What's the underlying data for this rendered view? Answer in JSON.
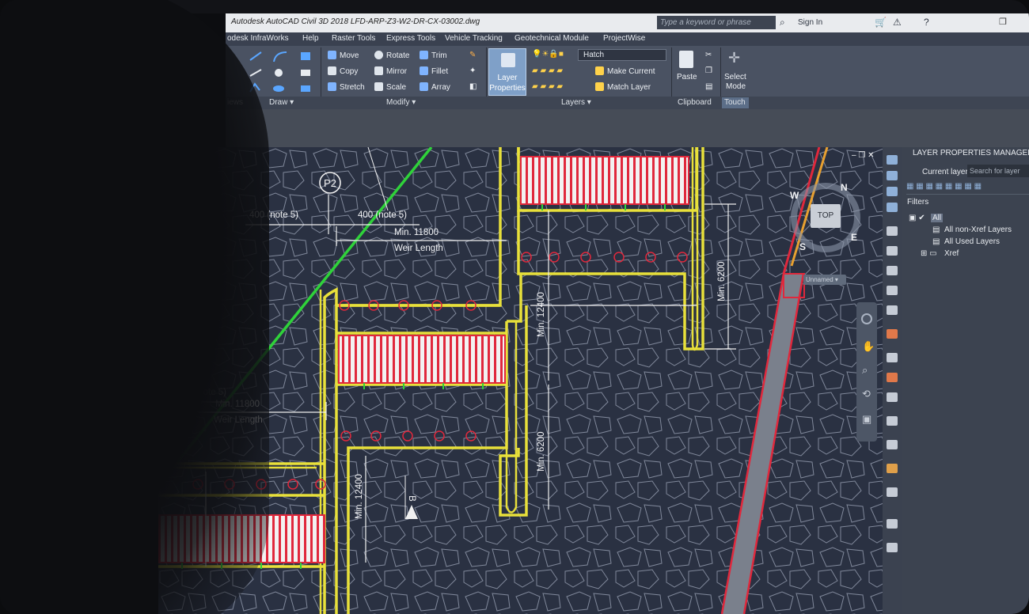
{
  "window": {
    "title": "Autodesk AutoCAD Civil 3D 2018    LFD-ARP-Z3-W2-DR-CX-03002.dwg",
    "search_placeholder": "Type a keyword or phrase",
    "sign_in": "Sign In"
  },
  "menu": [
    "odesk InfraWorks",
    "Help",
    "Raster Tools",
    "Express Tools",
    "Vehicle Tracking",
    "Geotechnical Module",
    "ProjectWise"
  ],
  "ribbon": {
    "panels": [
      "iews",
      "Draw ▾",
      "Modify ▾",
      "Layers ▾",
      "Clipboard",
      "Touch"
    ],
    "modify": [
      "Move",
      "Rotate",
      "Trim",
      "Copy",
      "Mirror",
      "Fillet",
      "Stretch",
      "Scale",
      "Array"
    ],
    "layer_properties": [
      "Layer",
      "Properties"
    ],
    "hatch_dropdown": "Hatch",
    "layers": [
      "Make Current",
      "Match Layer"
    ],
    "clipboard": "Paste",
    "touch": [
      "Select",
      "Mode"
    ]
  },
  "drawing": {
    "callout": "P2",
    "dims": [
      "400 (note 5)",
      "400 (note 5)",
      "Min. 11800",
      "Weir Length",
      "400 (note 5)",
      "Min. 11800",
      "Weir Length"
    ],
    "vertical_dims": [
      "Min. 12400",
      "Min. 6200",
      "Min. 6200",
      "Min. 12400"
    ],
    "section_mark": "B",
    "colors": {
      "background": "#2a3142",
      "yellow": "#e8e03a",
      "red": "#e0283c",
      "green": "#2fd23a",
      "white": "#f0f0f0",
      "linework": "#aab1c2"
    }
  },
  "viewcube": {
    "top": "TOP",
    "n": "N",
    "e": "E",
    "s": "S",
    "w": "W",
    "ucs": "Unnamed ▾"
  },
  "layer_panel": {
    "title": "LAYER PROPERTIES MANAGER",
    "current_layer": "Current layer",
    "search_placeholder": "Search for layer",
    "filters_label": "Filters",
    "tree": [
      "All",
      "All non-Xref Layers",
      "All Used Layers",
      "Xref"
    ]
  }
}
